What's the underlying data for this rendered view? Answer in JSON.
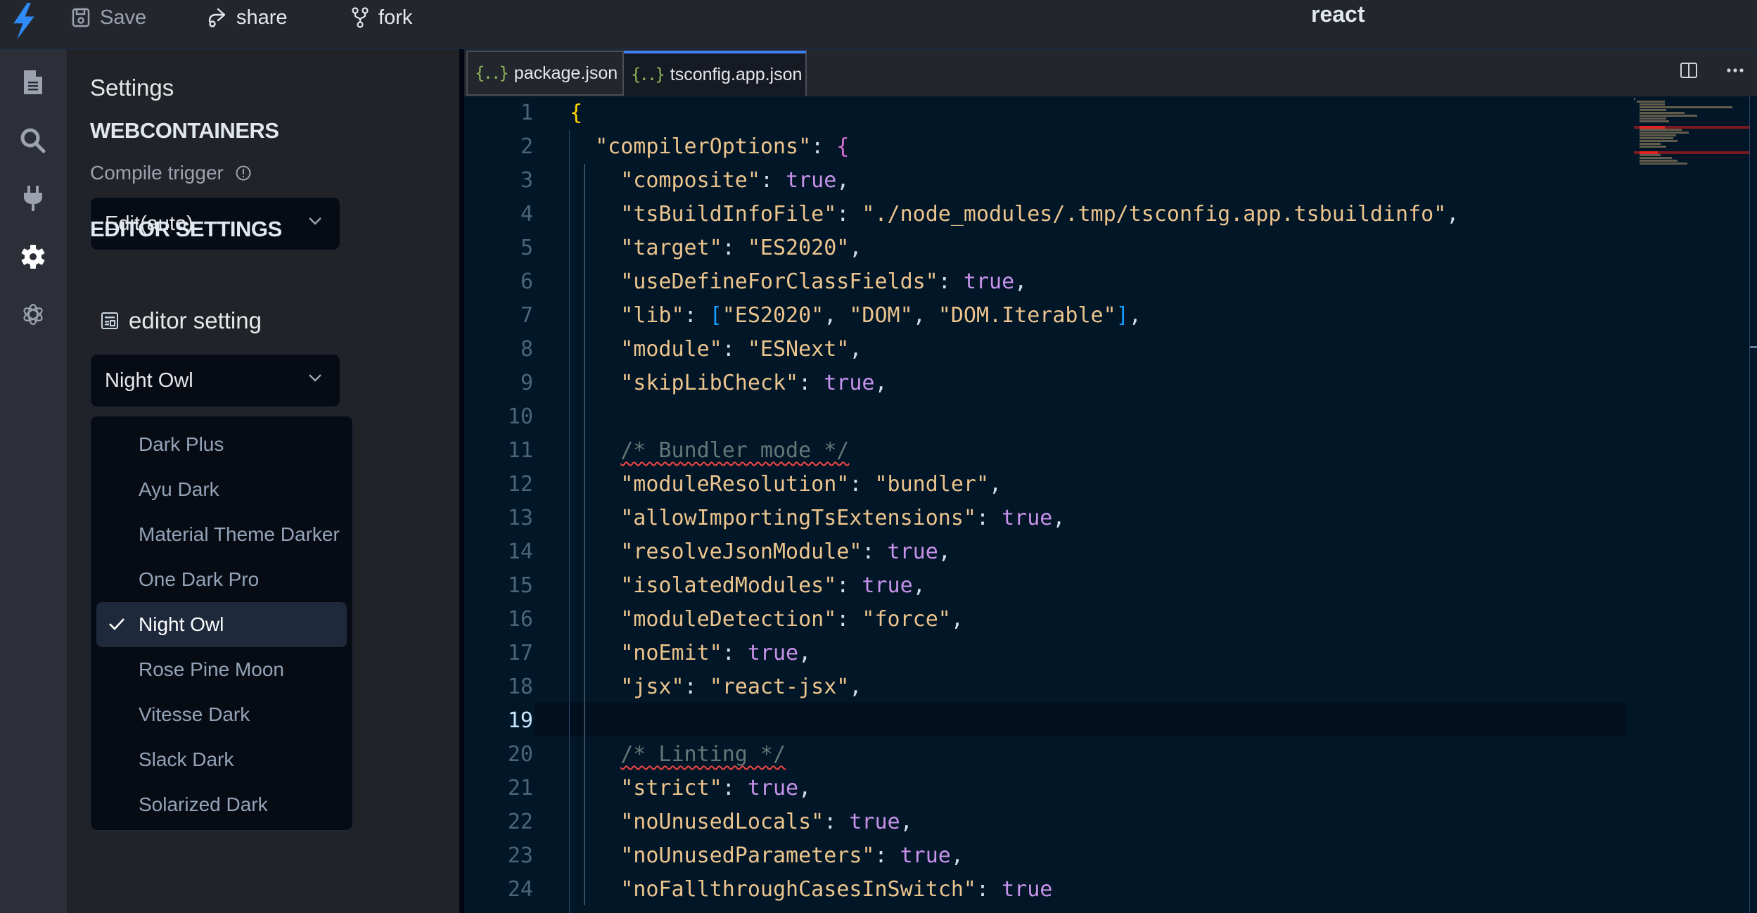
{
  "header": {
    "app_title": "react",
    "buttons": {
      "save": "Save",
      "share": "share",
      "fork": "fork"
    }
  },
  "activity_bar": {
    "items": [
      {
        "icon": "file-icon",
        "active": false
      },
      {
        "icon": "search-icon",
        "active": false
      },
      {
        "icon": "plug-icon",
        "active": false
      },
      {
        "icon": "gear-icon",
        "active": true
      },
      {
        "icon": "openai-icon",
        "active": false
      }
    ]
  },
  "sidebar": {
    "title": "Settings",
    "webcontainers": {
      "heading": "WEBCONTAINERS",
      "compile_trigger_label": "Compile trigger",
      "compile_trigger_value": "Edit(auto)"
    },
    "editor_settings": {
      "heading": "EDITOR SETTINGS",
      "row_label": "editor setting",
      "theme_value": "Night Owl",
      "theme_options": [
        {
          "label": "Dark Plus",
          "selected": false
        },
        {
          "label": "Ayu Dark",
          "selected": false
        },
        {
          "label": "Material Theme Darker",
          "selected": false
        },
        {
          "label": "One Dark Pro",
          "selected": false
        },
        {
          "label": "Night Owl",
          "selected": true
        },
        {
          "label": "Rose Pine Moon",
          "selected": false
        },
        {
          "label": "Vitesse Dark",
          "selected": false
        },
        {
          "label": "Slack Dark",
          "selected": false
        },
        {
          "label": "Solarized Dark",
          "selected": false
        }
      ]
    }
  },
  "editor": {
    "tabs": [
      {
        "label": "package.json",
        "icon": "{..}",
        "active": false
      },
      {
        "label": "tsconfig.app.json",
        "icon": "{..}",
        "active": true
      }
    ],
    "active_line": 19,
    "lines": [
      {
        "n": "1",
        "tokens": [
          [
            "br1",
            "{"
          ]
        ]
      },
      {
        "n": "2",
        "tokens": [
          [
            "p",
            "  "
          ],
          [
            "k",
            "\"compilerOptions\""
          ],
          [
            "p",
            ": "
          ],
          [
            "br2",
            "{"
          ]
        ]
      },
      {
        "n": "3",
        "tokens": [
          [
            "p",
            "    "
          ],
          [
            "k",
            "\"composite\""
          ],
          [
            "p",
            ": "
          ],
          [
            "b",
            "true"
          ],
          [
            "p",
            ","
          ]
        ]
      },
      {
        "n": "4",
        "tokens": [
          [
            "p",
            "    "
          ],
          [
            "k",
            "\"tsBuildInfoFile\""
          ],
          [
            "p",
            ": "
          ],
          [
            "s",
            "\"./node_modules/.tmp/tsconfig.app.tsbuildinfo\""
          ],
          [
            "p",
            ","
          ]
        ]
      },
      {
        "n": "5",
        "tokens": [
          [
            "p",
            "    "
          ],
          [
            "k",
            "\"target\""
          ],
          [
            "p",
            ": "
          ],
          [
            "s",
            "\"ES2020\""
          ],
          [
            "p",
            ","
          ]
        ]
      },
      {
        "n": "6",
        "tokens": [
          [
            "p",
            "    "
          ],
          [
            "k",
            "\"useDefineForClassFields\""
          ],
          [
            "p",
            ": "
          ],
          [
            "b",
            "true"
          ],
          [
            "p",
            ","
          ]
        ]
      },
      {
        "n": "7",
        "tokens": [
          [
            "p",
            "    "
          ],
          [
            "k",
            "\"lib\""
          ],
          [
            "p",
            ": "
          ],
          [
            "br3",
            "["
          ],
          [
            "s",
            "\"ES2020\""
          ],
          [
            "p",
            ", "
          ],
          [
            "s",
            "\"DOM\""
          ],
          [
            "p",
            ", "
          ],
          [
            "s",
            "\"DOM.Iterable\""
          ],
          [
            "br3",
            "]"
          ],
          [
            "p",
            ","
          ]
        ]
      },
      {
        "n": "8",
        "tokens": [
          [
            "p",
            "    "
          ],
          [
            "k",
            "\"module\""
          ],
          [
            "p",
            ": "
          ],
          [
            "s",
            "\"ESNext\""
          ],
          [
            "p",
            ","
          ]
        ]
      },
      {
        "n": "9",
        "tokens": [
          [
            "p",
            "    "
          ],
          [
            "k",
            "\"skipLibCheck\""
          ],
          [
            "p",
            ": "
          ],
          [
            "b",
            "true"
          ],
          [
            "p",
            ","
          ]
        ]
      },
      {
        "n": "10",
        "tokens": []
      },
      {
        "n": "11",
        "tokens": [
          [
            "p",
            "    "
          ],
          [
            "c",
            "/* Bundler mode */"
          ]
        ]
      },
      {
        "n": "12",
        "tokens": [
          [
            "p",
            "    "
          ],
          [
            "k",
            "\"moduleResolution\""
          ],
          [
            "p",
            ": "
          ],
          [
            "s",
            "\"bundler\""
          ],
          [
            "p",
            ","
          ]
        ]
      },
      {
        "n": "13",
        "tokens": [
          [
            "p",
            "    "
          ],
          [
            "k",
            "\"allowImportingTsExtensions\""
          ],
          [
            "p",
            ": "
          ],
          [
            "b",
            "true"
          ],
          [
            "p",
            ","
          ]
        ]
      },
      {
        "n": "14",
        "tokens": [
          [
            "p",
            "    "
          ],
          [
            "k",
            "\"resolveJsonModule\""
          ],
          [
            "p",
            ": "
          ],
          [
            "b",
            "true"
          ],
          [
            "p",
            ","
          ]
        ]
      },
      {
        "n": "15",
        "tokens": [
          [
            "p",
            "    "
          ],
          [
            "k",
            "\"isolatedModules\""
          ],
          [
            "p",
            ": "
          ],
          [
            "b",
            "true"
          ],
          [
            "p",
            ","
          ]
        ]
      },
      {
        "n": "16",
        "tokens": [
          [
            "p",
            "    "
          ],
          [
            "k",
            "\"moduleDetection\""
          ],
          [
            "p",
            ": "
          ],
          [
            "s",
            "\"force\""
          ],
          [
            "p",
            ","
          ]
        ]
      },
      {
        "n": "17",
        "tokens": [
          [
            "p",
            "    "
          ],
          [
            "k",
            "\"noEmit\""
          ],
          [
            "p",
            ": "
          ],
          [
            "b",
            "true"
          ],
          [
            "p",
            ","
          ]
        ]
      },
      {
        "n": "18",
        "tokens": [
          [
            "p",
            "    "
          ],
          [
            "k",
            "\"jsx\""
          ],
          [
            "p",
            ": "
          ],
          [
            "s",
            "\"react-jsx\""
          ],
          [
            "p",
            ","
          ]
        ]
      },
      {
        "n": "19",
        "tokens": []
      },
      {
        "n": "20",
        "tokens": [
          [
            "p",
            "    "
          ],
          [
            "c",
            "/* Linting */"
          ]
        ]
      },
      {
        "n": "21",
        "tokens": [
          [
            "p",
            "    "
          ],
          [
            "k",
            "\"strict\""
          ],
          [
            "p",
            ": "
          ],
          [
            "b",
            "true"
          ],
          [
            "p",
            ","
          ]
        ]
      },
      {
        "n": "22",
        "tokens": [
          [
            "p",
            "    "
          ],
          [
            "k",
            "\"noUnusedLocals\""
          ],
          [
            "p",
            ": "
          ],
          [
            "b",
            "true"
          ],
          [
            "p",
            ","
          ]
        ]
      },
      {
        "n": "23",
        "tokens": [
          [
            "p",
            "    "
          ],
          [
            "k",
            "\"noUnusedParameters\""
          ],
          [
            "p",
            ": "
          ],
          [
            "b",
            "true"
          ],
          [
            "p",
            ","
          ]
        ]
      },
      {
        "n": "24",
        "tokens": [
          [
            "p",
            "    "
          ],
          [
            "k",
            "\"noFallthroughCasesInSwitch\""
          ],
          [
            "p",
            ": "
          ],
          [
            "b",
            "true"
          ]
        ]
      }
    ]
  },
  "colors": {
    "accent": "#3b82f6",
    "editor_bg": "#011627",
    "string": "#ecc48d",
    "boolean": "#c792ea",
    "comment": "#637777",
    "error_squiggle": "#f44747"
  }
}
